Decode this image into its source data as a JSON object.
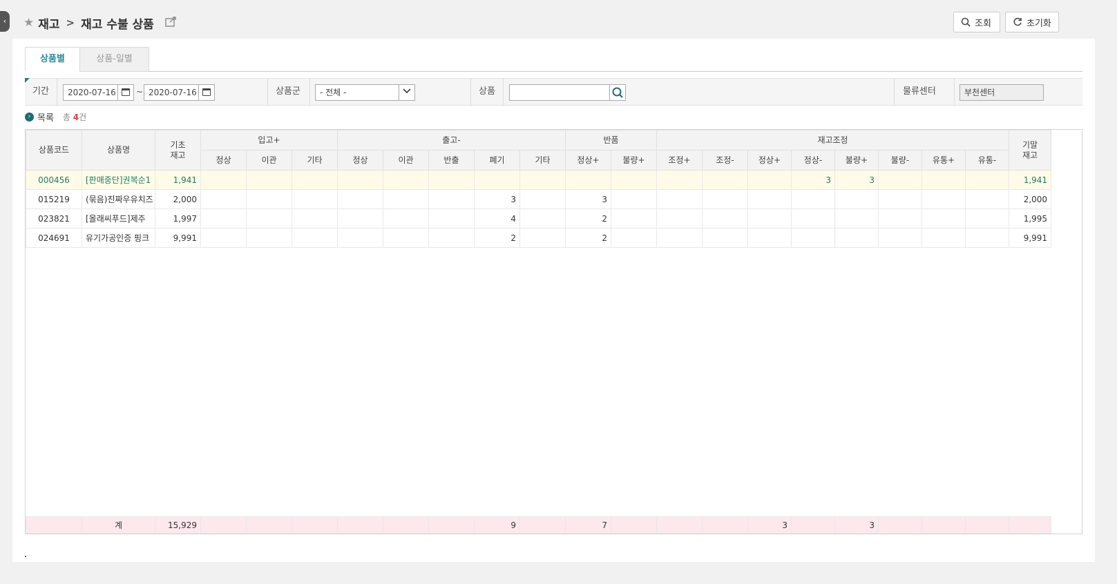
{
  "breadcrumb": {
    "root": "재고",
    "separator": ">",
    "page": "재고 수불 상품"
  },
  "buttons": {
    "search": "조회",
    "reset": "초기화"
  },
  "tabs": [
    {
      "label": "상품별",
      "active": true
    },
    {
      "label": "상품-일별",
      "active": false
    }
  ],
  "filters": {
    "period_label": "기간",
    "date_from": "2020-07-16",
    "tilde": "~",
    "date_to": "2020-07-16",
    "group_label": "상품군",
    "group_value": "- 전체 -",
    "product_label": "상품",
    "product_value": "",
    "center_label": "물류센터",
    "center_value": "부천센터"
  },
  "list": {
    "title": "목록",
    "total_prefix": "총",
    "total_count": "4",
    "total_suffix": "건"
  },
  "grid": {
    "headers": {
      "code": "상품코드",
      "name": "상품명",
      "begin_1": "기초",
      "begin_2": "재고",
      "in": "입고+",
      "out": "출고-",
      "ret": "반품",
      "adj": "재고조정",
      "end_1": "기말",
      "end_2": "재고"
    },
    "subheaders": [
      "정상",
      "이관",
      "기타",
      "정상",
      "이관",
      "반출",
      "폐기",
      "기타",
      "정상+",
      "불량+",
      "조정+",
      "조정-",
      "정상+",
      "정상-",
      "불량+",
      "불량-",
      "유통+",
      "유통-"
    ],
    "rows": [
      {
        "code": "000456",
        "name": "[판매중단]권복순1",
        "begin": "1,941",
        "cells": [
          "",
          "",
          "",
          "",
          "",
          "",
          "",
          "",
          "",
          "",
          "",
          "",
          "",
          "3",
          "3",
          "",
          "",
          ""
        ],
        "end": "1,941",
        "selected": true
      },
      {
        "code": "015219",
        "name": "(묶음)진짜우유치즈",
        "begin": "2,000",
        "cells": [
          "",
          "",
          "",
          "",
          "",
          "",
          "3",
          "",
          "3",
          "",
          "",
          "",
          "",
          "",
          "",
          "",
          "",
          ""
        ],
        "end": "2,000",
        "selected": false
      },
      {
        "code": "023821",
        "name": "[올래씨푸드]제주",
        "begin": "1,997",
        "cells": [
          "",
          "",
          "",
          "",
          "",
          "",
          "4",
          "",
          "2",
          "",
          "",
          "",
          "",
          "",
          "",
          "",
          "",
          ""
        ],
        "end": "1,995",
        "selected": false
      },
      {
        "code": "024691",
        "name": "유기가공인증 핑크",
        "begin": "9,991",
        "cells": [
          "",
          "",
          "",
          "",
          "",
          "",
          "2",
          "",
          "2",
          "",
          "",
          "",
          "",
          "",
          "",
          "",
          "",
          ""
        ],
        "end": "9,991",
        "selected": false
      }
    ],
    "total": {
      "label": "계",
      "begin": "15,929",
      "cells": [
        "",
        "",
        "",
        "",
        "",
        "",
        "9",
        "",
        "7",
        "",
        "",
        "",
        "3",
        "",
        "3",
        "",
        "",
        ""
      ],
      "end": ""
    }
  },
  "colors": {
    "accent": "#2a8a9a",
    "selected_row": "#fffbe8",
    "total_row": "#fde8ee",
    "count": "#e04040"
  }
}
